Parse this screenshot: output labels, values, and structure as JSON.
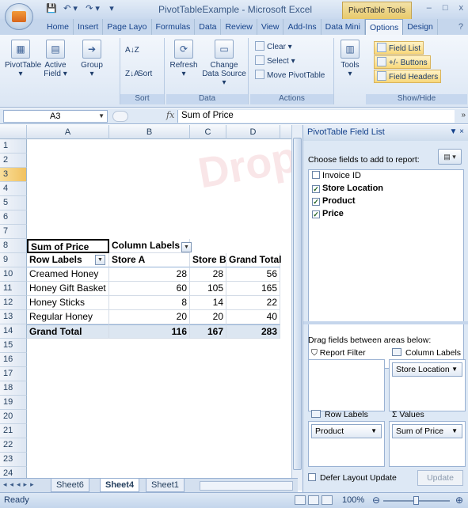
{
  "window": {
    "title": "PivotTableExample - Microsoft Excel",
    "context_tab": "PivotTable Tools",
    "min": "–",
    "max": "□",
    "close": "x"
  },
  "qat": {
    "save": "💾",
    "undo": "↶ ▾",
    "redo": "↷ ▾",
    "customize": "▾"
  },
  "tabs": [
    "Home",
    "Insert",
    "Page Layo",
    "Formulas",
    "Data",
    "Review",
    "View",
    "Add-Ins",
    "Data Mini",
    "Options",
    "Design"
  ],
  "active_tab": "Options",
  "ribbon": {
    "pivottable": "PivotTable",
    "active_field": "Active Field",
    "group": "Group",
    "sort_az": "A↓Z",
    "sort_za": "Z↓A",
    "sort": "Sort",
    "sort_group": "Sort",
    "refresh": "Refresh",
    "change_source": "Change Data Source",
    "data_group": "Data",
    "clear": "Clear ▾",
    "select": "Select ▾",
    "move": "Move PivotTable",
    "actions_group": "Actions",
    "tools": "Tools",
    "field_list": "Field List",
    "buttons": "+/- Buttons",
    "field_headers": "Field Headers",
    "showhide_group": "Show/Hide"
  },
  "formula_bar": {
    "cell_ref": "A3",
    "fx": "fx",
    "value": "Sum of Price"
  },
  "grid": {
    "columns": [
      "A",
      "B",
      "C",
      "D"
    ],
    "rows": [
      "1",
      "2",
      "3",
      "4",
      "5",
      "6",
      "7",
      "8",
      "9",
      "10",
      "11",
      "12",
      "13",
      "14",
      "15",
      "16",
      "17",
      "18",
      "19",
      "20",
      "21",
      "22",
      "23",
      "24"
    ],
    "a3": "Sum of Price",
    "b3": "Column Labels",
    "a4": "Row Labels",
    "b4": "Store A",
    "c4": "Store B",
    "d4": "Grand Total",
    "data_rows": [
      {
        "label": "Creamed Honey",
        "a": "28",
        "b": "28",
        "t": "56"
      },
      {
        "label": "Honey Gift Basket",
        "a": "60",
        "b": "105",
        "t": "165"
      },
      {
        "label": "Honey Sticks",
        "a": "8",
        "b": "14",
        "t": "22"
      },
      {
        "label": "Regular Honey",
        "a": "20",
        "b": "20",
        "t": "40"
      }
    ],
    "total": {
      "label": "Grand Total",
      "a": "116",
      "b": "167",
      "t": "283"
    }
  },
  "sheets": [
    "Sheet6",
    "Sheet4",
    "Sheet1"
  ],
  "active_sheet": "Sheet4",
  "status": {
    "ready": "Ready",
    "zoom": "100%"
  },
  "field_list": {
    "title": "PivotTable Field List",
    "choose": "Choose fields to add to report:",
    "fields": [
      {
        "name": "Invoice ID",
        "checked": false
      },
      {
        "name": "Store Location",
        "checked": true
      },
      {
        "name": "Product",
        "checked": true
      },
      {
        "name": "Price",
        "checked": true
      }
    ],
    "drag_text": "Drag fields between areas below:",
    "report_filter": "Report Filter",
    "column_labels": "Column Labels",
    "row_labels": "Row Labels",
    "values": "Values",
    "column_chip": "Store Location",
    "row_chip": "Product",
    "value_chip": "Sum of Price",
    "defer": "Defer Layout Update",
    "update": "Update"
  },
  "colors": {
    "accent": "#15428b",
    "ribbon_bg": "#dbe6f4",
    "total_row": "#dce6f1"
  }
}
